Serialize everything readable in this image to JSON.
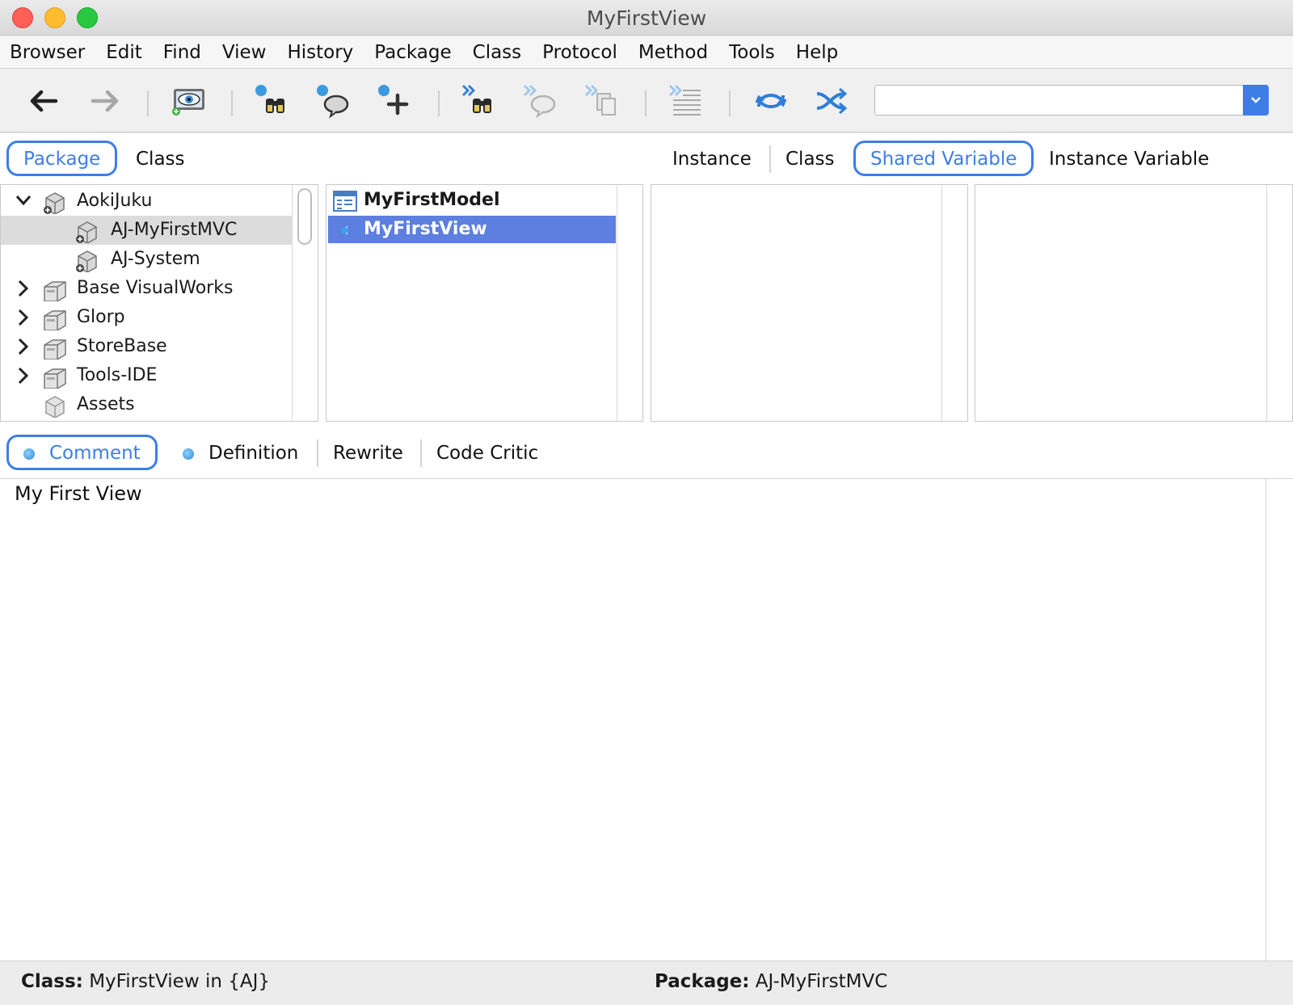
{
  "window": {
    "title": "MyFirstView"
  },
  "menu": [
    "Browser",
    "Edit",
    "Find",
    "View",
    "History",
    "Package",
    "Class",
    "Protocol",
    "Method",
    "Tools",
    "Help"
  ],
  "toolbar": {
    "buttons": [
      "back-arrow-icon",
      "forward-arrow-icon",
      "visibility-icon",
      "find-class-icon",
      "find-method-icon",
      "add-icon",
      "find-next-icon",
      "find-next-method-icon",
      "copy-icon",
      "lines-icon",
      "sync-icon",
      "shuffle-icon"
    ],
    "search_value": ""
  },
  "scope_tabs": {
    "left": [
      "Package",
      "Class"
    ],
    "selected_left": "Package",
    "right": [
      "Instance",
      "Class",
      "Shared Variable",
      "Instance Variable"
    ],
    "selected_right": "Shared Variable"
  },
  "packages": [
    {
      "label": "AokiJuku",
      "expander": "expanded"
    },
    {
      "label": "AJ-MyFirstMVC",
      "expander": "none",
      "selected": true
    },
    {
      "label": "AJ-System",
      "expander": "none"
    },
    {
      "label": "Base VisualWorks",
      "expander": "collapsed"
    },
    {
      "label": "Glorp",
      "expander": "collapsed"
    },
    {
      "label": "StoreBase",
      "expander": "collapsed"
    },
    {
      "label": "Tools-IDE",
      "expander": "collapsed"
    },
    {
      "label": "Assets",
      "expander": "none"
    }
  ],
  "classes": [
    {
      "label": "MyFirstModel",
      "selected": false
    },
    {
      "label": "MyFirstView",
      "selected": true
    }
  ],
  "editor_tabs": [
    "Comment",
    "Definition",
    "Rewrite",
    "Code Critic"
  ],
  "editor_selected_tab": "Comment",
  "editor": {
    "text": "My First View"
  },
  "status": {
    "class_label": "Class:",
    "class_value": "MyFirstView in {AJ}",
    "package_label": "Package:",
    "package_value": "AJ-MyFirstMVC"
  },
  "colors": {
    "accent": "#3d7ee6",
    "selection": "#5c7fe0"
  }
}
